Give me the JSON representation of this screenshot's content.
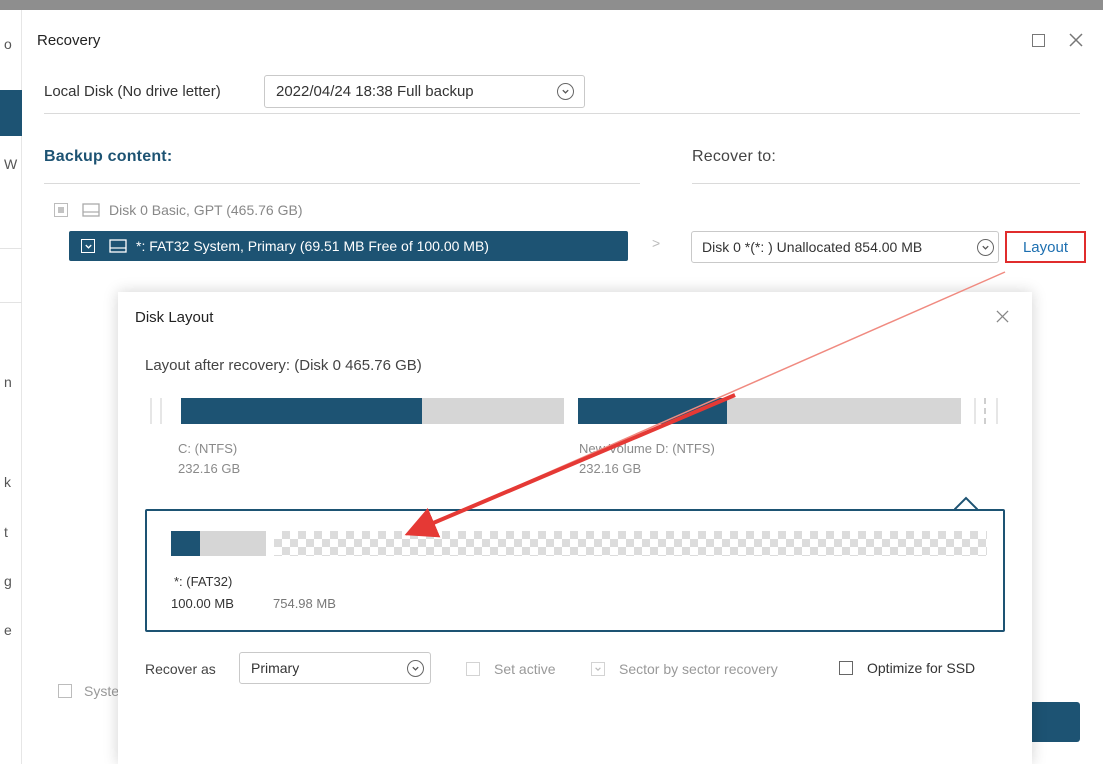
{
  "window": {
    "title": "Recovery"
  },
  "left_window": {
    "fragments": [
      "o",
      "W",
      "n",
      "k",
      "t",
      "g",
      "e"
    ]
  },
  "source": {
    "label": "Local Disk (No drive letter)",
    "selected_backup": "2022/04/24 18:38 Full backup"
  },
  "backup_content": {
    "title": "Backup content:",
    "disk_label": "Disk 0 Basic, GPT (465.76 GB)",
    "selected_partition": "*: FAT32 System, Primary (69.51 MB Free of 100.00 MB)"
  },
  "recover_to": {
    "title": "Recover to:",
    "target": "Disk 0 *(*: ) Unallocated 854.00 MB",
    "layout_link": "Layout",
    "arrow": ">"
  },
  "bottom_left": {
    "system_checkbox_label": "Syste"
  },
  "disk_layout": {
    "title": "Disk Layout",
    "subtitle": "Layout after recovery: (Disk 0 465.76 GB)",
    "partitions": [
      {
        "name": "C: (NTFS)",
        "size": "232.16 GB",
        "used_fraction": 0.63
      },
      {
        "name": "New Volume D: (NTFS)",
        "size": "232.16 GB",
        "used_fraction": 0.39
      }
    ],
    "detail": {
      "partition_name": "*: (FAT32)",
      "partition_size": "100.00 MB",
      "unallocated_size": "754.98 MB",
      "used_fraction": 0.3
    },
    "recover_as_label": "Recover as",
    "recover_as_value": "Primary",
    "options": {
      "set_active": "Set active",
      "sector_by_sector": "Sector by sector recovery",
      "optimize_ssd": "Optimize for SSD"
    }
  },
  "colors": {
    "accent": "#1d5373",
    "link": "#1d6fb0",
    "highlight_border": "#e02c2c",
    "annotation_arrow": "#e53935"
  },
  "icons": {
    "close": "close-icon",
    "maximize": "maximize-icon",
    "dropdown": "chevron-down-icon",
    "disk": "disk-icon"
  }
}
